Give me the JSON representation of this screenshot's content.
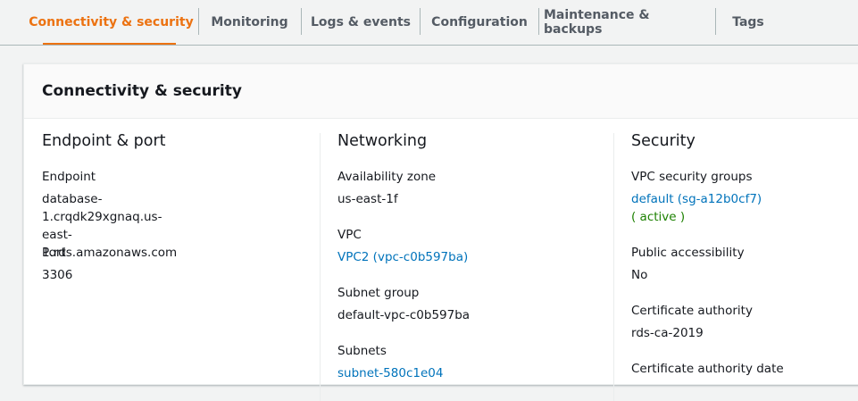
{
  "tabs": [
    {
      "label": "Connectivity & security",
      "active": true
    },
    {
      "label": "Monitoring"
    },
    {
      "label": "Logs & events"
    },
    {
      "label": "Configuration"
    },
    {
      "label": "Maintenance & backups"
    },
    {
      "label": "Tags"
    }
  ],
  "panel": {
    "title": "Connectivity & security",
    "endpoint_port": {
      "title": "Endpoint & port",
      "endpoint_label": "Endpoint",
      "endpoint_line1": "database-1.crqdk29xgnaq.us-east-",
      "endpoint_line2": "1.rds.amazonaws.com",
      "port_label": "Port",
      "port_value": "3306"
    },
    "networking": {
      "title": "Networking",
      "az_label": "Availability zone",
      "az_value": "us-east-1f",
      "vpc_label": "VPC",
      "vpc_value": "VPC2 (vpc-c0b597ba)",
      "subnet_group_label": "Subnet group",
      "subnet_group_value": "default-vpc-c0b597ba",
      "subnets_label": "Subnets",
      "subnets_value": "subnet-580c1e04"
    },
    "security": {
      "title": "Security",
      "sg_label": "VPC security groups",
      "sg_value": "default (sg-a12b0cf7)",
      "sg_status": "( active )",
      "public_label": "Public accessibility",
      "public_value": "No",
      "ca_label": "Certificate authority",
      "ca_value": "rds-ca-2019",
      "ca_date_label": "Certificate authority date"
    }
  },
  "colors": {
    "accent": "#ec7211",
    "link": "#0073bb",
    "active_status": "#1d8102"
  }
}
